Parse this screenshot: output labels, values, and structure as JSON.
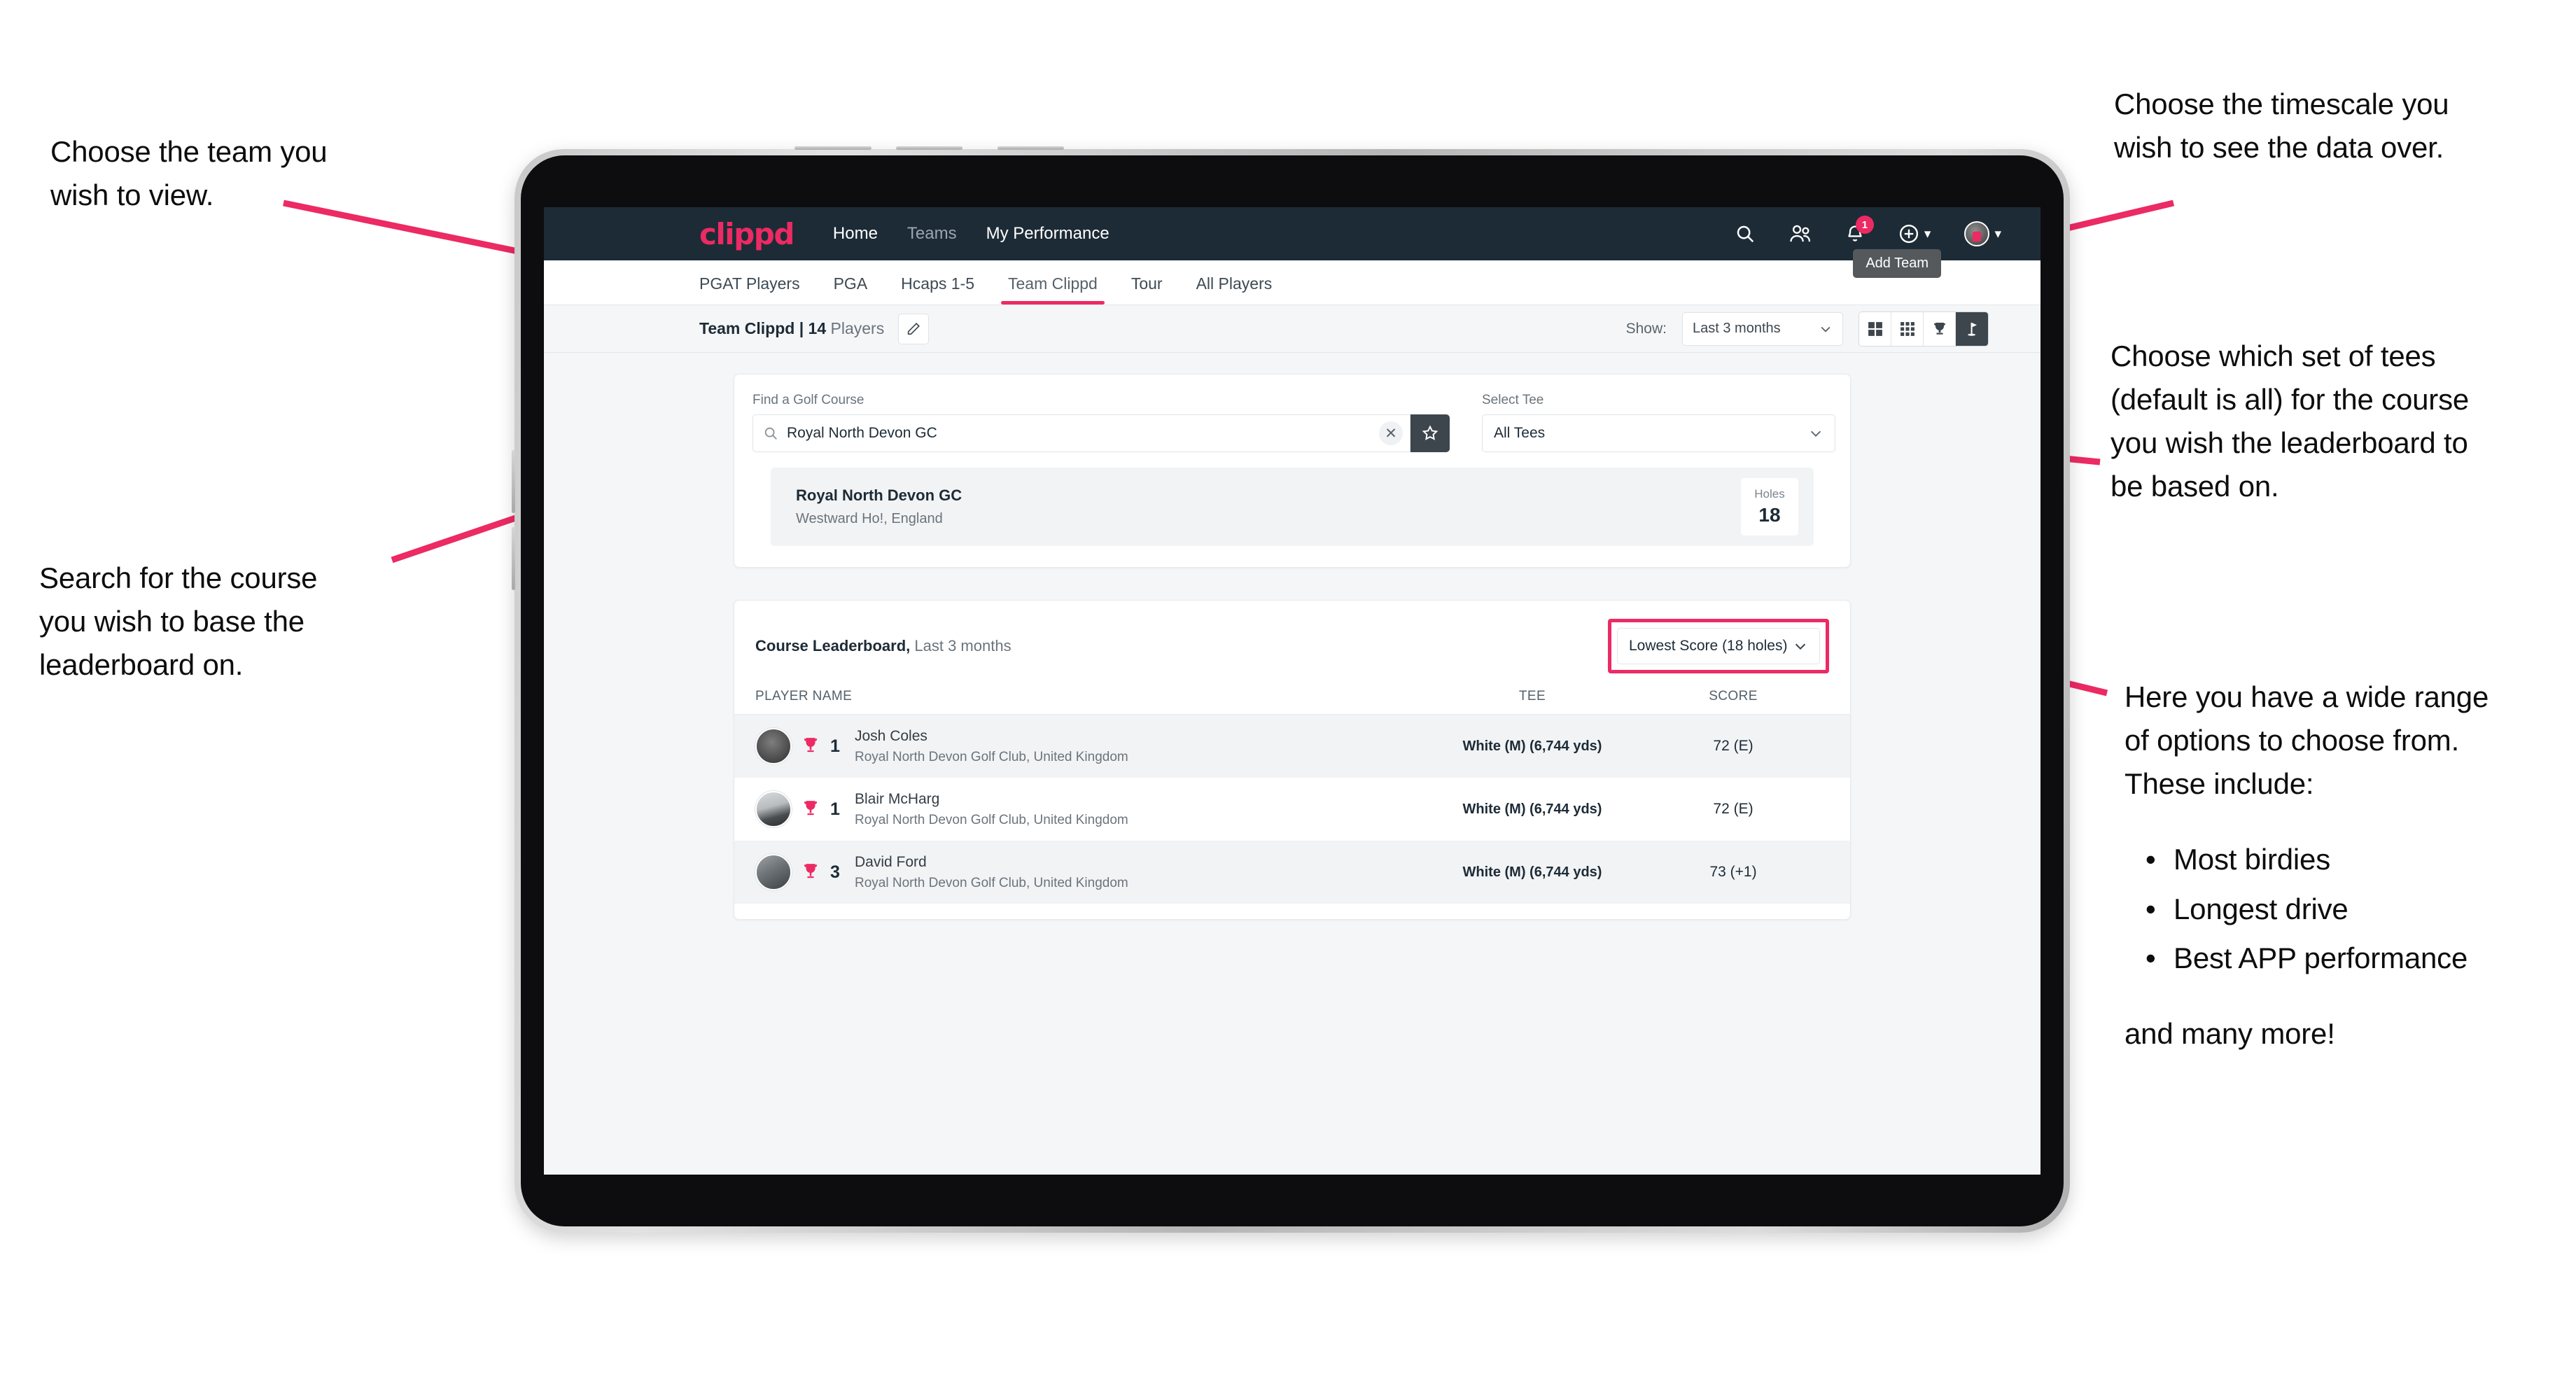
{
  "annotations": {
    "team": "Choose the team you\nwish to view.",
    "search": "Search for the course\nyou wish to base the\nleaderboard on.",
    "timescale": "Choose the timescale you\nwish to see the data over.",
    "tees": "Choose which set of tees\n(default is all) for the course\nyou wish the leaderboard to\nbe based on.",
    "options_intro": "Here you have a wide range\nof options to choose from.\nThese include:",
    "options_list": [
      "Most birdies",
      "Longest drive",
      "Best APP performance"
    ],
    "options_tail": "and many more!"
  },
  "app": {
    "brand": "clippd",
    "nav_links": [
      {
        "label": "Home",
        "dim": false
      },
      {
        "label": "Teams",
        "dim": true
      },
      {
        "label": "My Performance",
        "dim": false
      }
    ],
    "nav_icons": {
      "search": "search-icon",
      "people": "people-icon",
      "notifications": "bell-icon",
      "notification_count": "1",
      "add": "plus-circle-icon",
      "profile": "avatar-icon"
    },
    "tooltip": "Add Team",
    "tabs": [
      {
        "label": "PGAT Players",
        "active": false
      },
      {
        "label": "PGA",
        "active": false
      },
      {
        "label": "Hcaps 1-5",
        "active": false
      },
      {
        "label": "Team Clippd",
        "active": true
      },
      {
        "label": "Tour",
        "active": false
      },
      {
        "label": "All Players",
        "active": false
      }
    ],
    "toolbar": {
      "team_name": "Team Clippd | ",
      "team_count": "14",
      "team_suffix": " Players",
      "edit_icon": "pencil-icon",
      "show_label": "Show:",
      "show_value": "Last 3 months",
      "views": [
        {
          "icon": "grid-large-icon",
          "active": false
        },
        {
          "icon": "grid-small-icon",
          "active": false
        },
        {
          "icon": "trophy-icon",
          "active": false
        },
        {
          "icon": "golf-flag-icon",
          "active": true
        }
      ]
    },
    "search_card": {
      "course_label": "Find a Golf Course",
      "course_value": "Royal North Devon GC",
      "course_placeholder": "Find a Golf Course",
      "clear_icon": "close-icon",
      "star_icon": "star-icon",
      "tee_label": "Select Tee",
      "tee_value": "All Tees"
    },
    "course_result": {
      "name": "Royal North Devon GC",
      "location": "Westward Ho!, England",
      "holes_label": "Holes",
      "holes_value": "18"
    },
    "leaderboard": {
      "title": "Course Leaderboard,",
      "subtitle": " Last 3 months",
      "metric": "Lowest Score (18 holes)",
      "columns": [
        "PLAYER NAME",
        "TEE",
        "SCORE"
      ],
      "rows": [
        {
          "rank": "1",
          "name": "Josh Coles",
          "club": "Royal North Devon Golf Club, United Kingdom",
          "tee": "White (M) (6,744 yds)",
          "score": "72 (E)"
        },
        {
          "rank": "1",
          "name": "Blair McHarg",
          "club": "Royal North Devon Golf Club, United Kingdom",
          "tee": "White (M) (6,744 yds)",
          "score": "72 (E)"
        },
        {
          "rank": "3",
          "name": "David Ford",
          "club": "Royal North Devon Golf Club, United Kingdom",
          "tee": "White (M) (6,744 yds)",
          "score": "73 (+1)"
        }
      ]
    }
  },
  "colors": {
    "accent": "#ec2a63",
    "navbar": "#1d2b36",
    "page_bg": "#f4f6f8"
  }
}
